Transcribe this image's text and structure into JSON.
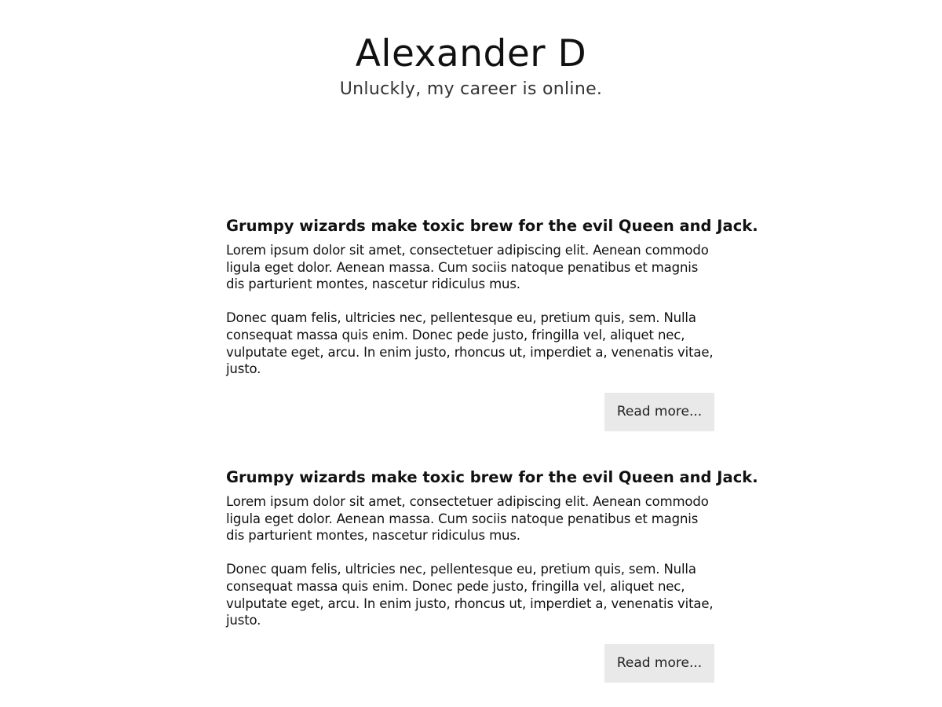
{
  "header": {
    "title": "Alexander D",
    "tagline": "Unluckly, my career is online."
  },
  "articles": [
    {
      "title": "Grumpy wizards make toxic brew for the evil Queen and Jack.",
      "paragraphs": [
        "Lorem ipsum dolor sit amet, consectetuer adipiscing elit. Aenean commodo ligula eget dolor. Aenean massa. Cum sociis natoque penatibus et magnis dis parturient montes, nascetur ridiculus mus.",
        "Donec quam felis, ultricies nec, pellentesque eu, pretium quis, sem. Nulla consequat massa quis enim. Donec pede justo, fringilla vel, aliquet nec, vulputate eget, arcu. In enim justo, rhoncus ut, imperdiet a, venenatis vitae, justo."
      ],
      "read_more_label": "Read more..."
    },
    {
      "title": "Grumpy wizards make toxic brew for the evil Queen and Jack.",
      "paragraphs": [
        "Lorem ipsum dolor sit amet, consectetuer adipiscing elit. Aenean commodo ligula eget dolor. Aenean massa. Cum sociis natoque penatibus et magnis dis parturient montes, nascetur ridiculus mus.",
        "Donec quam felis, ultricies nec, pellentesque eu, pretium quis, sem. Nulla consequat massa quis enim. Donec pede justo, fringilla vel, aliquet nec, vulputate eget, arcu. In enim justo, rhoncus ut, imperdiet a, venenatis vitae, justo."
      ],
      "read_more_label": "Read more..."
    }
  ],
  "colors": {
    "background": "#ffffff",
    "text": "#111111",
    "button_background": "#e9e9e9"
  }
}
